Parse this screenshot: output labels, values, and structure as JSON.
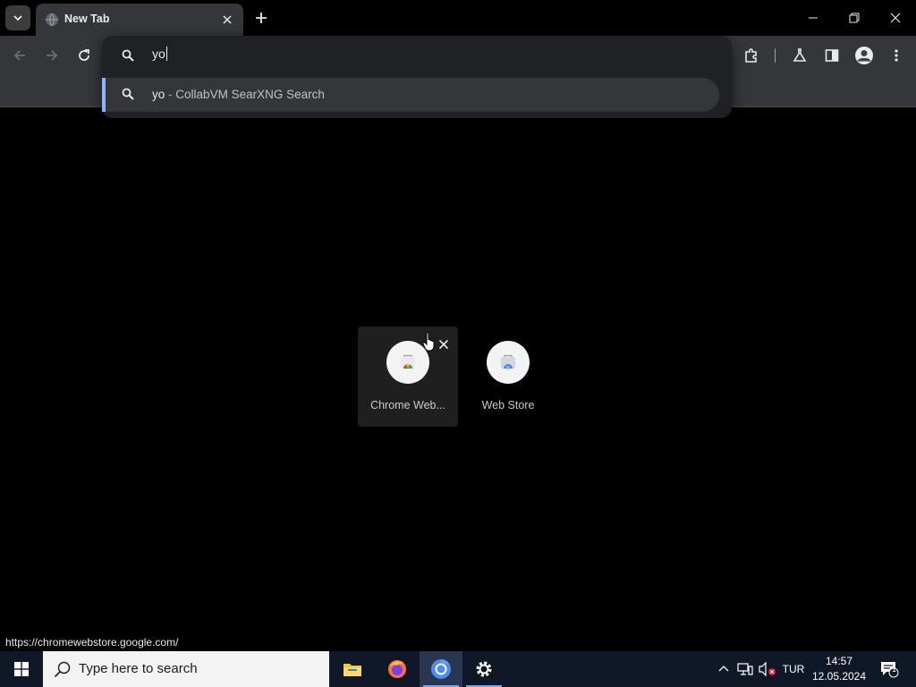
{
  "browser": {
    "tab": {
      "title": "New Tab"
    },
    "omnibox": {
      "typed_text": "yo"
    },
    "suggestion": {
      "query": "yo",
      "separator": "-",
      "description": "CollabVM SearXNG Search"
    }
  },
  "shortcuts": [
    {
      "label": "Chrome Web..."
    },
    {
      "label": "Web Store"
    }
  ],
  "status_bar": {
    "url": "https://chromewebstore.google.com/"
  },
  "taskbar": {
    "search_placeholder": "Type here to search",
    "language": "TUR",
    "time": "14:57",
    "date": "12.05.2024",
    "notification_count": "1"
  },
  "colors": {
    "accent": "#8ab4f8",
    "toolbar": "#35363a",
    "omnibox_bg": "#202124",
    "taskbar": "#101828"
  }
}
